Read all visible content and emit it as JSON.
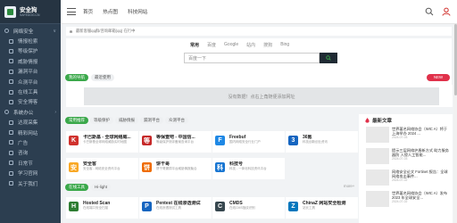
{
  "sidebar": {
    "logo_title": "安全狗",
    "logo_sub": "SAFEDOG.CN",
    "items": [
      {
        "label": "网络安全",
        "kind": "top",
        "arrow": "∨"
      },
      {
        "label": "情报检索",
        "kind": "sub"
      },
      {
        "label": "等级保护",
        "kind": "sub"
      },
      {
        "label": "威胁情报",
        "kind": "sub"
      },
      {
        "label": "漏洞平台",
        "kind": "sub"
      },
      {
        "label": "众测平台",
        "kind": "sub"
      },
      {
        "label": "在线工具",
        "kind": "sub"
      },
      {
        "label": "安全博客",
        "kind": "sub"
      },
      {
        "label": "系统办公",
        "kind": "top",
        "arrow": "›"
      },
      {
        "label": "达观采集",
        "kind": "sub"
      },
      {
        "label": "精彩网站",
        "kind": "sub"
      },
      {
        "label": "广告",
        "kind": "sub"
      },
      {
        "label": "咨询",
        "kind": "sub"
      },
      {
        "label": "日常节",
        "kind": "sub"
      },
      {
        "label": "学习官网",
        "kind": "sub"
      },
      {
        "label": "关于我们",
        "kind": "sub"
      }
    ]
  },
  "topbar": {
    "links": [
      "首页",
      "热点图",
      "科技网站"
    ]
  },
  "notice": {
    "text": "最新客服qq群/咨询邮箱(qq) 在行中"
  },
  "search": {
    "engines": [
      "常用",
      "百度",
      "Google",
      "站内",
      "搜狗",
      "Bing"
    ],
    "active_engine": "常用",
    "placeholder": "百度一下"
  },
  "hot_tabs": [
    "我的导航",
    "最近使用"
  ],
  "new_badge": "NEW",
  "empty_message": "没有数据！点右上角随便添加网址",
  "category_tabs": [
    "常用推荐",
    "等级保护",
    "威胁情报",
    "漏洞平台",
    "众测平台"
  ],
  "cards_row1": [
    {
      "title": "卡巴斯基 - 全球网络威...",
      "desc": "卡巴斯基全球网络威胁实时地图",
      "icon_text": "K",
      "icon_color": "#d0312d"
    },
    {
      "title": "等保查吧 - 中国信...",
      "desc": "等级保护测评备案查询平台",
      "icon_text": "等",
      "icon_color": "#c62828"
    },
    {
      "title": "Freebuf",
      "desc": "国内网络安全行业门户",
      "icon_text": "F",
      "icon_color": "#1e88e5"
    },
    {
      "title": "36氪",
      "desc": "科技创新创业资讯",
      "icon_text": "3",
      "icon_color": "#1565c0"
    }
  ],
  "cards_row2": [
    {
      "title": "安全客",
      "desc": "安全客 - 网络安全资讯平台",
      "icon_text": "安",
      "icon_color": "#f9a825"
    },
    {
      "title": "饼干哥",
      "desc": "饼干哥漏洞平台威胁情报聚合",
      "icon_text": "饼",
      "icon_color": "#ef6c00"
    },
    {
      "title": "科技号",
      "desc": "科技 - 一体化科技资讯平台",
      "icon_text": "科",
      "icon_color": "#1976d2"
    }
  ],
  "online_tabs": [
    "在线工具",
    "Hi-light"
  ],
  "more_label": "more+",
  "cards_row3": [
    {
      "title": "Hosted Scan",
      "desc": "在线端口安全扫描",
      "icon_text": "H",
      "icon_color": "#2e7d32"
    },
    {
      "title": "Pentest 在线渗透测试",
      "desc": "在线渗透测试工具",
      "icon_text": "P",
      "icon_color": "#1565c0"
    },
    {
      "title": "CMDS",
      "desc": "在线CMS指纹识别",
      "icon_text": "C",
      "icon_color": "#37474f"
    },
    {
      "title": "ChinaZ 网站安全检测",
      "desc": "站长工具",
      "icon_text": "Z",
      "icon_color": "#0277bd"
    }
  ],
  "side_panel": {
    "title": "最新文章",
    "articles": [
      {
        "title": "世界著名网络协会（WIC A）将于上海举办 2024 ...",
        "date": "2024-07-03"
      },
      {
        "title": "提示三层网络护盾新方式 助力服务器防 入侵人工智能...",
        "date": "2024-07-03"
      },
      {
        "title": "网络安全论文 Fortinet 报告：全球网络攻击事件...",
        "date": "2024-07-02"
      },
      {
        "title": "世界著名网络协会（WIC A）发布2023 年全球安全...",
        "date": "2024-07-02"
      }
    ]
  },
  "colors": {
    "sidebar_bg": "#2c3e50",
    "accent_green": "#3aa84a",
    "badge_red": "#e0314a"
  }
}
